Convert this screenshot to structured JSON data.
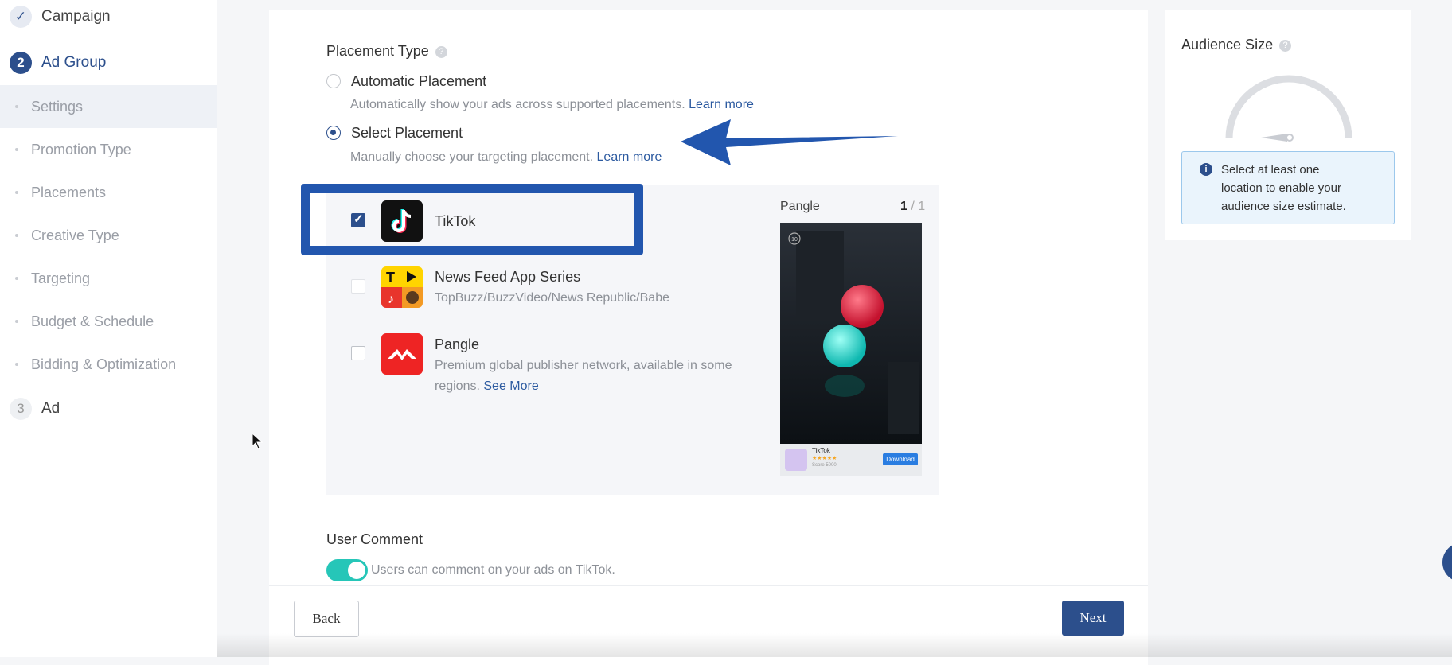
{
  "sidebar": {
    "steps": [
      {
        "label": "Campaign",
        "badge": "✓"
      },
      {
        "label": "Ad Group",
        "badge": "2"
      },
      {
        "label": "Ad",
        "badge": "3"
      }
    ],
    "sub_items": [
      "Settings",
      "Promotion Type",
      "Placements",
      "Creative Type",
      "Targeting",
      "Budget & Schedule",
      "Bidding & Optimization"
    ]
  },
  "placement": {
    "title": "Placement Type",
    "automatic": {
      "label": "Automatic Placement",
      "desc": "Automatically show your ads across supported placements.",
      "link": "Learn more"
    },
    "select": {
      "label": "Select Placement",
      "desc": "Manually choose your targeting placement.",
      "link": "Learn more"
    },
    "apps": [
      {
        "name": "TikTok",
        "checked": true
      },
      {
        "name": "News Feed App Series",
        "sub": "TopBuzz/BuzzVideo/News Republic/Babe",
        "checked": false
      },
      {
        "name": "Pangle",
        "sub_line1": "Premium global publisher network, available in some",
        "sub_line2": "regions.",
        "link": "See More",
        "checked": false
      }
    ],
    "preview": {
      "title": "Pangle",
      "page_current": "1",
      "page_sep": "/ 1",
      "app_name": "TikTok",
      "stars": "★★★★★",
      "score": "Score 5000",
      "download": "Download",
      "timer": "10"
    }
  },
  "user_comment": {
    "title": "User Comment",
    "desc": "Users can comment on your ads on TikTok.",
    "enabled": true
  },
  "footer": {
    "back": "Back",
    "next": "Next"
  },
  "audience": {
    "title": "Audience Size",
    "info_line1": "Select at least one",
    "info_line2": "location to enable your",
    "info_line3": "audience size estimate."
  },
  "colors": {
    "accent": "#2c4f8c",
    "highlight": "#2256ae",
    "toggle": "#26c6b8"
  }
}
